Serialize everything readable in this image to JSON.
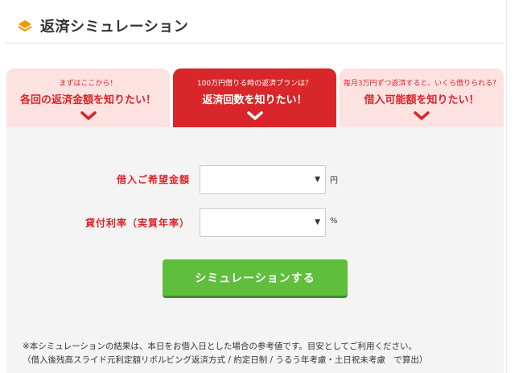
{
  "section": {
    "title": "返済シミュレーション",
    "icon": "layers-icon"
  },
  "tabs": [
    {
      "sub": "まずはここから！",
      "main": "各回の返済金額を知りたい！",
      "active": false
    },
    {
      "sub": "100万円借りる時の返済プランは？",
      "main": "返済回数を知りたい！",
      "active": true
    },
    {
      "sub": "毎月3万円ずつ返済すると、いくら借りられる？",
      "main": "借入可能額を知りたい！",
      "active": false
    }
  ],
  "form": {
    "amount_label": "借入ご希望金額",
    "amount_value": "",
    "amount_unit": "円",
    "rate_label": "貸付利率（実質年率）",
    "rate_value": "",
    "rate_unit": "%"
  },
  "button": {
    "label": "シミュレーションする"
  },
  "notes": {
    "line1": "※本シミュレーションの結果は、本日をお借入日とした場合の参考値です。目安としてご利用ください。",
    "line2": "（借入後残高スライド元利定額リボルビング返済方式 / 約定日制 / うるう年考慮・土日祝未考慮　で算出）"
  },
  "colors": {
    "accent_red": "#d9262a",
    "tab_pink": "#fde2e2",
    "button_green": "#5fbe3c",
    "icon_orange": "#f39800"
  }
}
